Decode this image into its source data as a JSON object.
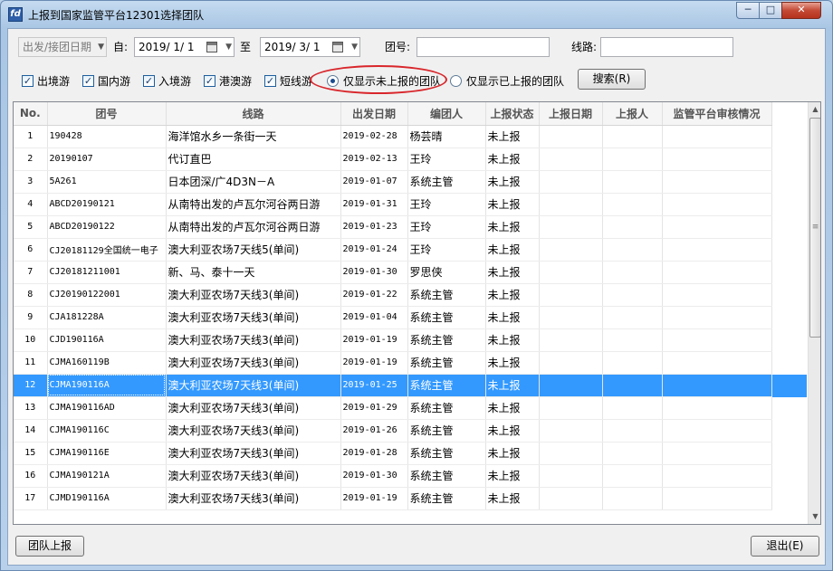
{
  "window": {
    "title": "上报到国家监管平台12301选择团队",
    "icon_text": "fd",
    "min": "─",
    "max": "□",
    "close": "✕"
  },
  "filter": {
    "date_type": "出发/接团日期",
    "from_label": "自:",
    "from_date": "2019/ 1/ 1",
    "to_label": "至",
    "to_date": "2019/ 3/ 1",
    "team_label": "团号:",
    "team_value": "",
    "route_label": "线路:",
    "route_value": ""
  },
  "options": {
    "checkboxes": [
      {
        "label": "出境游",
        "checked": true
      },
      {
        "label": "国内游",
        "checked": true
      },
      {
        "label": "入境游",
        "checked": true
      },
      {
        "label": "港澳游",
        "checked": true
      },
      {
        "label": "短线游",
        "checked": true
      }
    ],
    "radio_unreported": "仅显示未上报的团队",
    "radio_reported": "仅显示已上报的团队",
    "search_button": "搜索(R)"
  },
  "table": {
    "columns": [
      "No.",
      "团号",
      "线路",
      "出发日期",
      "编团人",
      "上报状态",
      "上报日期",
      "上报人",
      "监管平台审核情况"
    ],
    "selected_row": 12,
    "rows": [
      [
        "1",
        "190428",
        "海洋馆水乡一条街一天",
        "2019-02-28",
        "杨芸晴",
        "未上报",
        "",
        "",
        ""
      ],
      [
        "2",
        "20190107",
        "代订直巴",
        "2019-02-13",
        "王玲",
        "未上报",
        "",
        "",
        ""
      ],
      [
        "3",
        "5A261",
        "日本团深/广4D3N－A",
        "2019-01-07",
        "系统主管",
        "未上报",
        "",
        "",
        ""
      ],
      [
        "4",
        "ABCD20190121",
        "从南特出发的卢瓦尔河谷两日游",
        "2019-01-31",
        "王玲",
        "未上报",
        "",
        "",
        ""
      ],
      [
        "5",
        "ABCD20190122",
        "从南特出发的卢瓦尔河谷两日游",
        "2019-01-23",
        "王玲",
        "未上报",
        "",
        "",
        ""
      ],
      [
        "6",
        "CJ20181129全国统一电子",
        "澳大利亚农场7天线5(单间)",
        "2019-01-24",
        "王玲",
        "未上报",
        "",
        "",
        ""
      ],
      [
        "7",
        "CJ20181211001",
        "新、马、泰十一天",
        "2019-01-30",
        "罗思侠",
        "未上报",
        "",
        "",
        ""
      ],
      [
        "8",
        "CJ20190122001",
        "澳大利亚农场7天线3(单间)",
        "2019-01-22",
        "系统主管",
        "未上报",
        "",
        "",
        ""
      ],
      [
        "9",
        "CJA181228A",
        "澳大利亚农场7天线3(单间)",
        "2019-01-04",
        "系统主管",
        "未上报",
        "",
        "",
        ""
      ],
      [
        "10",
        "CJD190116A",
        "澳大利亚农场7天线3(单间)",
        "2019-01-19",
        "系统主管",
        "未上报",
        "",
        "",
        ""
      ],
      [
        "11",
        "CJMA160119B",
        "澳大利亚农场7天线3(单间)",
        "2019-01-19",
        "系统主管",
        "未上报",
        "",
        "",
        ""
      ],
      [
        "12",
        "CJMA190116A",
        "澳大利亚农场7天线3(单间)",
        "2019-01-25",
        "系统主管",
        "未上报",
        "",
        "",
        ""
      ],
      [
        "13",
        "CJMA190116AD",
        "澳大利亚农场7天线3(单间)",
        "2019-01-29",
        "系统主管",
        "未上报",
        "",
        "",
        ""
      ],
      [
        "14",
        "CJMA190116C",
        "澳大利亚农场7天线3(单间)",
        "2019-01-26",
        "系统主管",
        "未上报",
        "",
        "",
        ""
      ],
      [
        "15",
        "CJMA190116E",
        "澳大利亚农场7天线3(单间)",
        "2019-01-28",
        "系统主管",
        "未上报",
        "",
        "",
        ""
      ],
      [
        "16",
        "CJMA190121A",
        "澳大利亚农场7天线3(单间)",
        "2019-01-30",
        "系统主管",
        "未上报",
        "",
        "",
        ""
      ],
      [
        "17",
        "CJMD190116A",
        "澳大利亚农场7天线3(单间)",
        "2019-01-19",
        "系统主管",
        "未上报",
        "",
        "",
        ""
      ]
    ]
  },
  "footer": {
    "report_button": "团队上报",
    "exit_button": "退出(E)"
  }
}
